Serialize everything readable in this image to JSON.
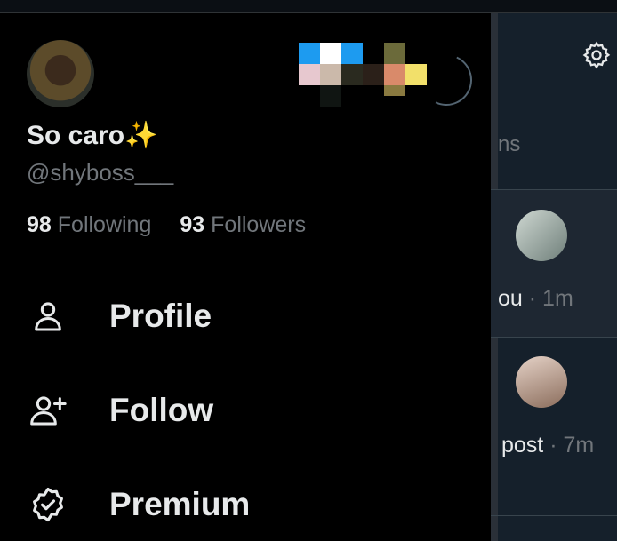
{
  "drawer": {
    "display_name": "So caro",
    "display_name_emoji": "✨",
    "handle": "@shyboss___",
    "following_count": "98",
    "following_label": "Following",
    "followers_count": "93",
    "followers_label": "Followers",
    "menu": [
      {
        "label": "Profile",
        "icon": "person-icon"
      },
      {
        "label": "Follow",
        "icon": "person-plus-icon"
      },
      {
        "label": "Premium",
        "icon": "verified-badge-icon"
      }
    ]
  },
  "background_feed": {
    "tab_fragment": "ns",
    "row1_fragment": "ou",
    "row1_time": "· 1m",
    "row2_fragment": "post",
    "row2_time": "· 7m",
    "settings_icon": "gear-icon"
  },
  "colors": {
    "drawer_bg": "#000000",
    "feed_bg": "#15202b",
    "primary_text": "#e7e9ea",
    "secondary_text": "#71767b",
    "sparkle": "#ffd23f"
  }
}
